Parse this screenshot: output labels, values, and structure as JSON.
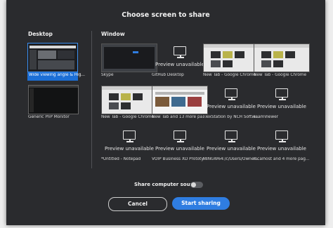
{
  "title": "Choose screen to share",
  "desktop": {
    "label": "Desktop",
    "items": [
      {
        "label": "Wide viewing angle & Hig..."
      },
      {
        "label": "Generic PnP Monitor"
      }
    ]
  },
  "window": {
    "label": "Window",
    "items": [
      {
        "label": "Skype"
      },
      {
        "label": "GitHub Desktop",
        "preview": "Preview unavailable"
      },
      {
        "label": "New Tab - Google Chrome"
      },
      {
        "label": "New Tab - Google Chrome"
      },
      {
        "label": "New Tab - Google Chrome"
      },
      {
        "label": "New Tab and 13 more pag..."
      },
      {
        "label": "FlexStation by NCH Softw...",
        "preview": "Preview unavailable"
      },
      {
        "label": "TeamViewer",
        "preview": "Preview unavailable"
      },
      {
        "label": "*Untitled - Notepad",
        "preview": "Preview unavailable"
      },
      {
        "label": "VOIP Business XD Prototyp...",
        "preview": "Preview unavailable"
      },
      {
        "label": "MINGW64:/c/Users/Owner...",
        "preview": "Preview unavailable"
      },
      {
        "label": "localhost and 4 more page...",
        "preview": "Preview unavailable"
      }
    ]
  },
  "sound": {
    "label": "Share computer sound"
  },
  "buttons": {
    "cancel": "Cancel",
    "start": "Start sharing"
  },
  "colors": {
    "dialog_bg": "#2a2b2e",
    "accent": "#2f7de1",
    "selected": "#1c6fd6"
  }
}
